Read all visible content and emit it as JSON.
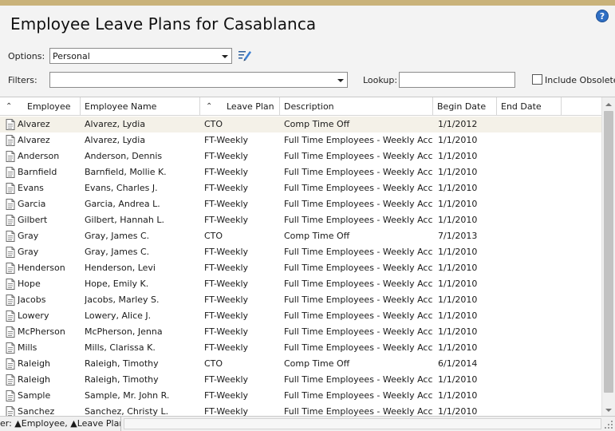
{
  "window": {
    "title": "Employee Leave Plans for Casablanca"
  },
  "toolbar": {
    "options_label": "Options:",
    "options_value": "Personal",
    "filters_label": "Filters:",
    "filters_value": "",
    "lookup_label": "Lookup:",
    "lookup_value": "",
    "include_obsolete_label": "Include Obsolete",
    "include_obsolete_checked": false
  },
  "grid": {
    "columns": [
      "Employee",
      "Employee Name",
      "Leave Plan",
      "Description",
      "Begin Date",
      "End Date"
    ],
    "sorted_columns": [
      "Employee",
      "Leave Plan"
    ],
    "rows": [
      {
        "employee": "Alvarez",
        "name": "Alvarez, Lydia",
        "plan": "CTO",
        "description": "Comp Time Off",
        "begin": "1/1/2012",
        "end": ""
      },
      {
        "employee": "Alvarez",
        "name": "Alvarez, Lydia",
        "plan": "FT-Weekly",
        "description": "Full Time Employees - Weekly Accrual",
        "begin": "1/1/2010",
        "end": ""
      },
      {
        "employee": "Anderson",
        "name": "Anderson, Dennis",
        "plan": "FT-Weekly",
        "description": "Full Time Employees - Weekly Accrual",
        "begin": "1/1/2010",
        "end": ""
      },
      {
        "employee": "Barnfield",
        "name": "Barnfield, Mollie K.",
        "plan": "FT-Weekly",
        "description": "Full Time Employees - Weekly Accrual",
        "begin": "1/1/2010",
        "end": ""
      },
      {
        "employee": "Evans",
        "name": "Evans, Charles J.",
        "plan": "FT-Weekly",
        "description": "Full Time Employees - Weekly Accrual",
        "begin": "1/1/2010",
        "end": ""
      },
      {
        "employee": "Garcia",
        "name": "Garcia, Andrea L.",
        "plan": "FT-Weekly",
        "description": "Full Time Employees - Weekly Accrual",
        "begin": "1/1/2010",
        "end": ""
      },
      {
        "employee": "Gilbert",
        "name": "Gilbert, Hannah L.",
        "plan": "FT-Weekly",
        "description": "Full Time Employees - Weekly Accrual",
        "begin": "1/1/2010",
        "end": ""
      },
      {
        "employee": "Gray",
        "name": "Gray, James C.",
        "plan": "CTO",
        "description": "Comp Time Off",
        "begin": "7/1/2013",
        "end": ""
      },
      {
        "employee": "Gray",
        "name": "Gray, James C.",
        "plan": "FT-Weekly",
        "description": "Full Time Employees - Weekly Accrual",
        "begin": "1/1/2010",
        "end": ""
      },
      {
        "employee": "Henderson",
        "name": "Henderson, Levi",
        "plan": "FT-Weekly",
        "description": "Full Time Employees - Weekly Accrual",
        "begin": "1/1/2010",
        "end": ""
      },
      {
        "employee": "Hope",
        "name": "Hope, Emily K.",
        "plan": "FT-Weekly",
        "description": "Full Time Employees - Weekly Accrual",
        "begin": "1/1/2010",
        "end": ""
      },
      {
        "employee": "Jacobs",
        "name": "Jacobs, Marley S.",
        "plan": "FT-Weekly",
        "description": "Full Time Employees - Weekly Accrual",
        "begin": "1/1/2010",
        "end": ""
      },
      {
        "employee": "Lowery",
        "name": "Lowery, Alice J.",
        "plan": "FT-Weekly",
        "description": "Full Time Employees - Weekly Accrual",
        "begin": "1/1/2010",
        "end": ""
      },
      {
        "employee": "McPherson",
        "name": "McPherson, Jenna",
        "plan": "FT-Weekly",
        "description": "Full Time Employees - Weekly Accrual",
        "begin": "1/1/2010",
        "end": ""
      },
      {
        "employee": "Mills",
        "name": "Mills, Clarissa K.",
        "plan": "FT-Weekly",
        "description": "Full Time Employees - Weekly Accrual",
        "begin": "1/1/2010",
        "end": ""
      },
      {
        "employee": "Raleigh",
        "name": "Raleigh, Timothy",
        "plan": "CTO",
        "description": "Comp Time Off",
        "begin": "6/1/2014",
        "end": ""
      },
      {
        "employee": "Raleigh",
        "name": "Raleigh, Timothy",
        "plan": "FT-Weekly",
        "description": "Full Time Employees - Weekly Accrual",
        "begin": "1/1/2010",
        "end": ""
      },
      {
        "employee": "Sample",
        "name": "Sample, Mr. John R.",
        "plan": "FT-Weekly",
        "description": "Full Time Employees - Weekly Accrual",
        "begin": "1/1/2010",
        "end": ""
      },
      {
        "employee": "Sanchez",
        "name": "Sanchez, Christy L.",
        "plan": "FT-Weekly",
        "description": "Full Time Employees - Weekly Accrual",
        "begin": "1/1/2010",
        "end": ""
      }
    ]
  },
  "statusbar": {
    "sort_text": "er: ▲Employee, ▲Leave Plan"
  },
  "icons": {
    "help": "help-icon",
    "edit": "edit-list-icon",
    "row": "document-icon",
    "sort": "sort-ascending-icon"
  },
  "colors": {
    "accent_bar": "#c9b27a",
    "selected_row": "#f4f1e8",
    "help_icon": "#2f6fc4"
  }
}
